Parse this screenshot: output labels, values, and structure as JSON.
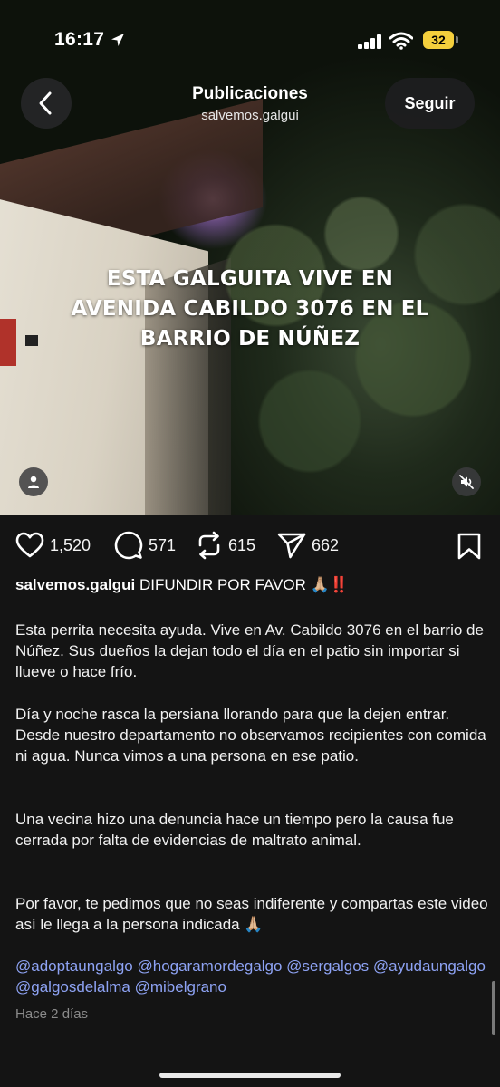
{
  "status_bar": {
    "time": "16:17",
    "battery": "32"
  },
  "header": {
    "title": "Publicaciones",
    "username": "salvemos.galgui",
    "follow_label": "Seguir"
  },
  "video": {
    "overlay_lines": [
      "ESTA GALGUITA VIVE EN",
      "AVENIDA CABILDO 3076 EN EL",
      "BARRIO DE NÚÑEZ"
    ]
  },
  "actions": {
    "likes": "1,520",
    "replies": "571",
    "reposts": "615",
    "shares": "662"
  },
  "caption": {
    "username": "salvemos.galgui",
    "headline": "DIFUNDIR POR FAVOR 🙏🏼‼️",
    "paragraphs": [
      "Esta perrita necesita ayuda. Vive en Av. Cabildo 3076 en el barrio de Núñez. Sus dueños la dejan todo el día en el patio sin importar si llueve o hace frío.",
      "Día y noche rasca la persiana llorando para que la dejen entrar. Desde nuestro departamento no observamos recipientes con comida ni agua. Nunca vimos a una persona en ese patio.",
      "Una vecina hizo una denuncia hace un tiempo pero la causa fue cerrada por falta de evidencias de maltrato animal.",
      " Por favor, te pedimos que no seas indiferente y compartas este video así le llega a la persona indicada 🙏🏼"
    ],
    "mentions": "@adoptaungalgo @hogaramordegalgo @sergalgos @ayudaungalgo @galgosdelalma @mibelgrano",
    "timestamp": "Hace 2 días"
  },
  "colors": {
    "mention": "#8ea3f4",
    "battery": "#f4cf3c",
    "background": "#141414"
  }
}
